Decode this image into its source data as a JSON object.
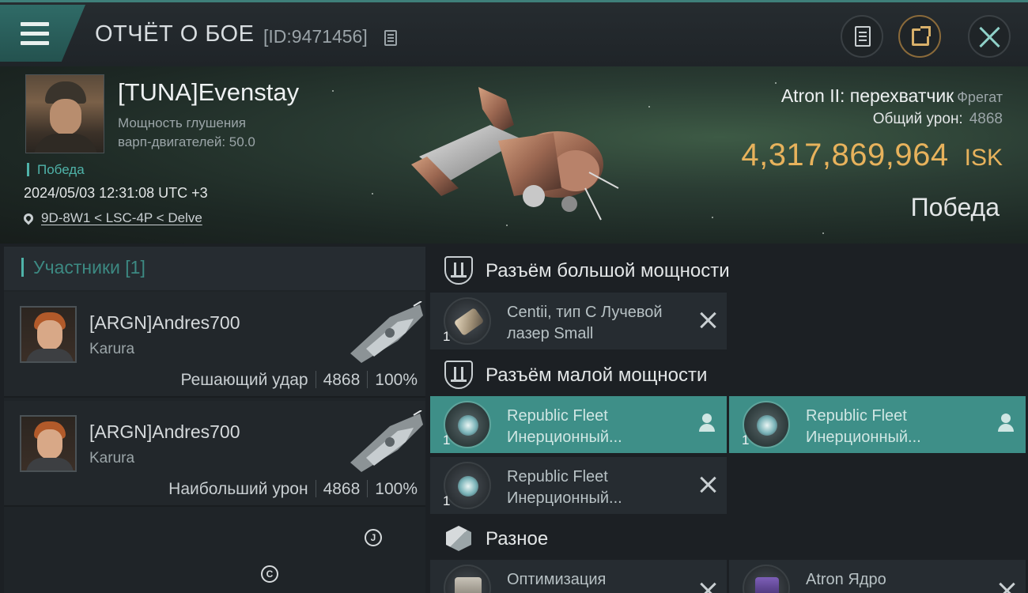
{
  "header": {
    "title": "ОТЧЁТ О БОЕ",
    "report_id": "[ID:9471456]"
  },
  "icons": {
    "menu": "menu-icon",
    "copy": "copy-icon",
    "clipboard": "clipboard-icon",
    "share": "share-icon",
    "close": "close-icon"
  },
  "victim": {
    "name": "[TUNA]Evenstay",
    "stat_line1": "Мощность глушения",
    "stat_line2": "варп-двигателей: 50.0",
    "result_tag": "Победа",
    "datetime": "2024/05/03 12:31:08 UTC +3",
    "location": "9D-8W1 < LSC-4P < Delve"
  },
  "ship": {
    "name": "Atron II: перехватчик",
    "class": "Фрегат",
    "total_damage_label": "Общий урон:",
    "total_damage_value": "4868",
    "isk_value": "4,317,869,964",
    "isk_unit": "ISK",
    "outcome": "Победа"
  },
  "participants": {
    "title": "Участники [1]",
    "items": [
      {
        "name": "[ARGN]Andres700",
        "ship": "Karura",
        "role": "Решающий удар",
        "damage": "4868",
        "percent": "100%"
      },
      {
        "name": "[ARGN]Andres700",
        "ship": "Karura",
        "role": "Наибольший урон",
        "damage": "4868",
        "percent": "100%"
      }
    ],
    "tag_j": "J",
    "tag_c": "C"
  },
  "fitting": {
    "high": {
      "title": "Разъём большой мощности",
      "modules": [
        {
          "qty": "1",
          "line1": "Centii, тип C Лучевой",
          "line2": "лазер Small"
        }
      ]
    },
    "low": {
      "title": "Разъём малой мощности",
      "modules": [
        {
          "qty": "1",
          "line1": "Republic Fleet",
          "line2": "Инерционный..."
        },
        {
          "qty": "1",
          "line1": "Republic Fleet",
          "line2": "Инерционный..."
        },
        {
          "qty": "1",
          "line1": "Republic Fleet",
          "line2": "Инерционный..."
        }
      ]
    },
    "misc": {
      "title": "Разное",
      "modules": [
        {
          "qty": "",
          "line1": "Оптимизация",
          "line2": ""
        },
        {
          "qty": "",
          "line1": "Atron Ядро",
          "line2": ""
        }
      ]
    }
  },
  "colors": {
    "accent": "#3e8f88",
    "isk": "#e7b25c",
    "victory": "#4fb3a9"
  }
}
